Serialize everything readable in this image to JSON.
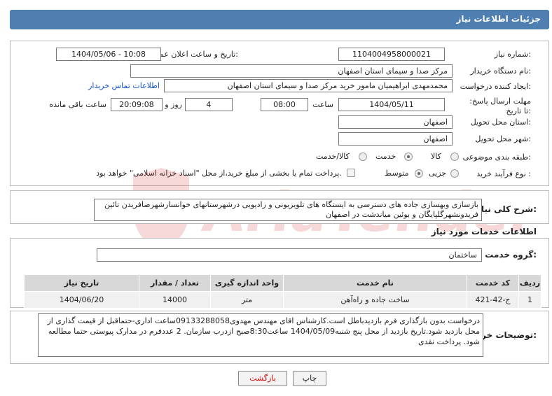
{
  "header": {
    "title": "جزئیات اطلاعات نیاز"
  },
  "fields": {
    "need_number_label": "شماره نیاز:",
    "need_number": "1104004958000021",
    "announce_label": "تاریخ و ساعت اعلان عمومی:",
    "announce_value": "1404/05/06 - 10:08",
    "buyer_org_label": "نام دستگاه خریدار:",
    "buyer_org": "مرکز صدا و سیمای استان اصفهان",
    "creator_label": "ایجاد کننده درخواست:",
    "creator": "محمدمهدی ابراهیمیان مامور خرید مرکز صدا و سیمای استان اصفهان",
    "contact_link": "اطلاعات تماس خریدار",
    "deadline_label": "مهلت ارسال پاسخ: تا تاریخ:",
    "deadline_date": "1404/05/11",
    "time_label": "ساعت",
    "deadline_time": "08:00",
    "days_value": "4",
    "days_label": "روز و",
    "remaining_time": "20:09:08",
    "remaining_label": "ساعت باقی مانده",
    "province_label": "استان محل تحویل:",
    "province": "اصفهان",
    "city_label": "شهر محل تحویل:",
    "city": "اصفهان",
    "category_label": "طبقه بندی موضوعی:",
    "category_options": [
      "کالا",
      "خدمت",
      "کالا/خدمت"
    ],
    "category_selected": "خدمت",
    "process_label": "نوع فرآیند خرید :",
    "process_options": [
      "جزیی",
      "متوسط"
    ],
    "process_selected": "متوسط",
    "payment_note": "پرداخت تمام یا بخشی از مبلغ خرید،از محل \"اسناد خزانه اسلامی\" خواهد بود."
  },
  "description": {
    "label": "شرح کلی نیاز:",
    "text": "بازسازی وبهسازی جاده های دسترسی به ایستگاه های تلویزیونی و رادیویی درشهرستانهای خوانسارشهرضافریدن تائین فریدونشهرگلپایگان و بوئین میاندشت در اصفهان"
  },
  "services": {
    "section_title": "اطلاعات خدمات مورد نیاز",
    "group_label": "گروه خدمت:",
    "group_value": "ساختمان",
    "columns": [
      "ردیف",
      "کد خدمت",
      "نام خدمت",
      "واحد اندازه گیری",
      "تعداد / مقدار",
      "تاریخ نیاز"
    ],
    "rows": [
      [
        "1",
        "ج-42-421",
        "ساخت جاده و راه‌آهن",
        "متر",
        "14000",
        "1404/06/20"
      ]
    ]
  },
  "buyer_notes": {
    "label": "توضیحات خریدار:",
    "text": "درخواست بدون بارگذاری فرم بازدیدباطل است.کارشناس اقای مهندس مهدوی09133288058ساعت اداری-حتماقبل از قیمت گذاری از محل بازدید شود.تاریخ بازدید از محل پنج شنبه1404/05/09 ساعت8:30صبح ازدرب سازمان. 2 عددفرم در مدارک پیوستی حتما مطالعه شود. پرداخت نقدی"
  },
  "buttons": {
    "print": "چاپ",
    "back": "بازگشت"
  },
  "colors": {
    "header": "#4e7fb0",
    "link": "#1155cc",
    "back_text": "#cc0000",
    "watermark": "#d32f2f"
  },
  "icons": {
    "watermark": "shield-watermark-icon"
  }
}
